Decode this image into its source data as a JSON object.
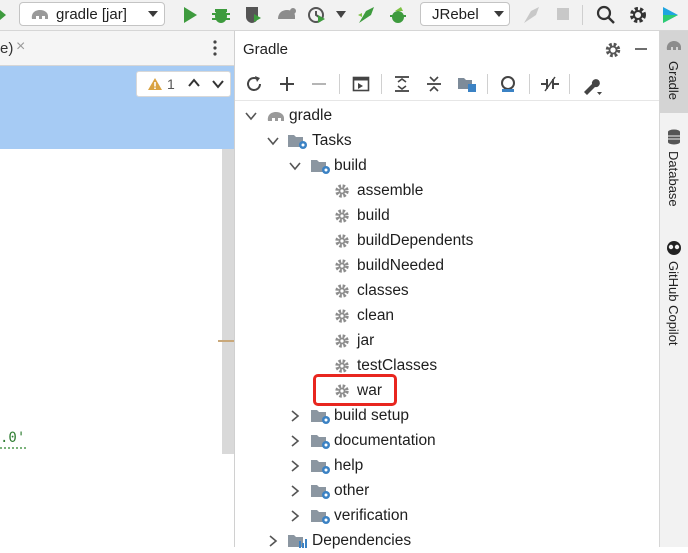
{
  "toolbar": {
    "run_config": "gradle [jar]",
    "jrebel": "JRebel"
  },
  "editor": {
    "tab_fragment": "e)",
    "tab_close": "×",
    "warnings_count": "1",
    "code_fragment": ".0'"
  },
  "gradle_panel": {
    "title": "Gradle",
    "tree": {
      "root": "gradle",
      "tasks": "Tasks",
      "build_group": "build",
      "build_tasks": [
        "assemble",
        "build",
        "buildDependents",
        "buildNeeded",
        "classes",
        "clean",
        "jar",
        "testClasses",
        "war"
      ],
      "other_groups": [
        "build setup",
        "documentation",
        "help",
        "other",
        "verification"
      ],
      "dependencies": "Dependencies"
    }
  },
  "side_stripe": {
    "items": [
      "Gradle",
      "Database",
      "GitHub Copilot"
    ]
  },
  "colors": {
    "selection": "#a6cbf4",
    "highlight_box": "#e8261f",
    "run_green": "#3e9b3e",
    "gear_gray": "#8c8c8c"
  }
}
